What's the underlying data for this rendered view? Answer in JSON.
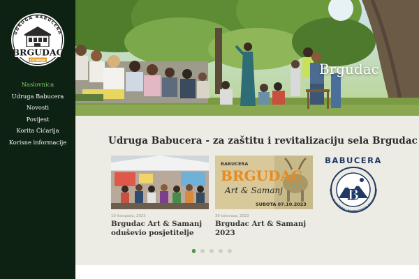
{
  "logo": {
    "arc_text": "UDRUGA BABUCERA",
    "wordmark": "BRGUDAC",
    "ribbon": "ĆIĆARIJA"
  },
  "nav": {
    "items": [
      {
        "label": "Naslovnica",
        "active": true
      },
      {
        "label": "Udruga Babucera",
        "active": false
      },
      {
        "label": "Novosti",
        "active": false
      },
      {
        "label": "Povijest",
        "active": false
      },
      {
        "label": "Korita Ćićarija",
        "active": false
      },
      {
        "label": "Korisne informacije",
        "active": false
      }
    ]
  },
  "hero": {
    "caption": "Brgudac"
  },
  "main": {
    "title": "Udruga Babucera - za zaštitu i revitalizaciju sela Brgudac",
    "cards": [
      {
        "date": "10 listopada, 2023",
        "title": "Brgudac Art & Samanj oduševio posjetitelje"
      },
      {
        "date": "30 kolovoza, 2023",
        "title": "Brgudac Art & Samanj 2023"
      }
    ],
    "poster": {
      "top": "BABUCERA",
      "headline": "BRGUDAC",
      "script": "Art & Samanj",
      "date": "SUBOTA 07.10.2023"
    },
    "brand_logo": {
      "name": "BABUCERA",
      "letter": "B",
      "arc": "UDRUGA ZA ZAŠTITU I REVITALIZACIJU SELA BRGUDAC"
    }
  },
  "slider": {
    "count": 5,
    "active_index": 0
  },
  "colors": {
    "sidebar_bg": "#0d2212",
    "nav_active": "#7fd26c",
    "content_bg": "#ecebe4",
    "brand_blue": "#1f3a63",
    "dot_active": "#4c9a45"
  }
}
